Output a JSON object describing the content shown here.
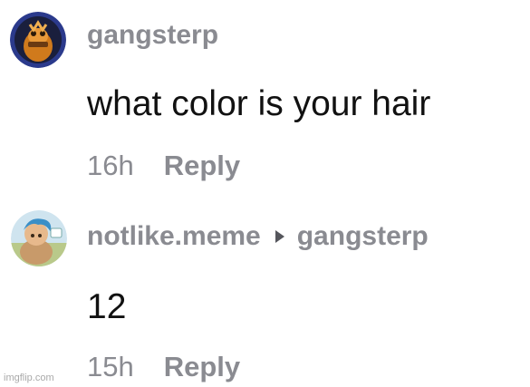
{
  "comments": [
    {
      "username": "gangsterp",
      "text": "what color is your hair",
      "time": "16h",
      "reply_label": "Reply",
      "avatar_icon": "character-avatar-icon"
    },
    {
      "username": "notlike.meme",
      "reply_to": "gangsterp",
      "text": "12",
      "time": "15h",
      "reply_label": "Reply",
      "avatar_icon": "anime-character-avatar-icon"
    }
  ],
  "watermark": "imgflip.com",
  "colors": {
    "username": "#8a8b91",
    "text": "#111111",
    "avatar1_ring": "#2b3a8c"
  }
}
